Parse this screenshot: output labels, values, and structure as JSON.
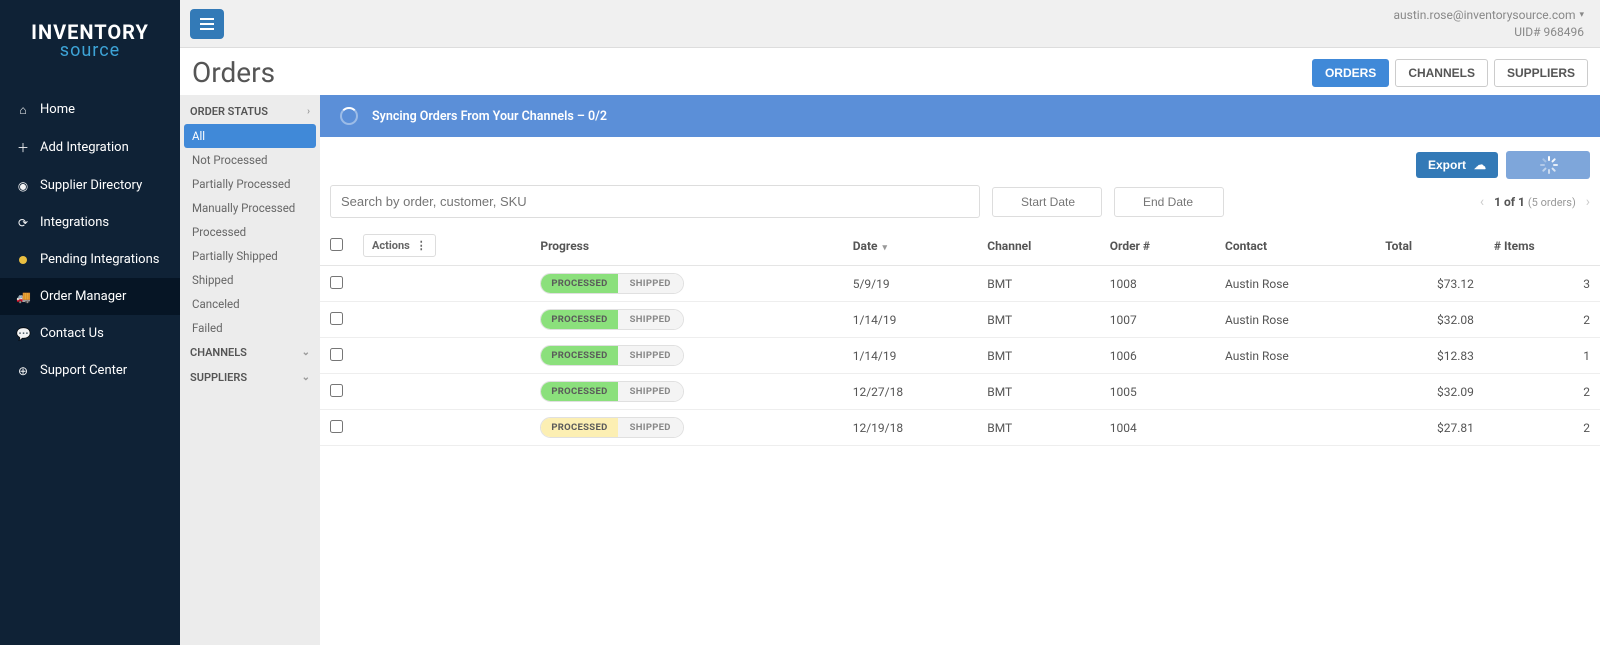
{
  "logo": {
    "line1": "INVENTORY",
    "line2": "source"
  },
  "topbar": {
    "email": "austin.rose@inventorysource.com",
    "uid_label": "UID# 968496"
  },
  "nav": {
    "home": "Home",
    "add_integration": "Add Integration",
    "supplier_directory": "Supplier Directory",
    "integrations": "Integrations",
    "pending_integrations": "Pending Integrations",
    "order_manager": "Order Manager",
    "contact_us": "Contact Us",
    "support_center": "Support Center"
  },
  "page": {
    "title": "Orders",
    "tabs": {
      "orders": "ORDERS",
      "channels": "CHANNELS",
      "suppliers": "SUPPLIERS"
    }
  },
  "filters": {
    "order_status_header": "ORDER STATUS",
    "statuses": {
      "all": "All",
      "not_processed": "Not Processed",
      "partially_processed": "Partially Processed",
      "manually_processed": "Manually Processed",
      "processed": "Processed",
      "partially_shipped": "Partially Shipped",
      "shipped": "Shipped",
      "canceled": "Canceled",
      "failed": "Failed"
    },
    "channels_header": "CHANNELS",
    "suppliers_header": "SUPPLIERS"
  },
  "banner": {
    "text": "Syncing Orders From Your Channels – 0/2"
  },
  "toolbar": {
    "export_label": "Export",
    "search_placeholder": "Search by order, customer, SKU",
    "start_date_placeholder": "Start Date",
    "end_date_placeholder": "End Date",
    "pager_main": "1 of 1",
    "pager_sub": "(5 orders)",
    "actions_label": "Actions"
  },
  "columns": {
    "progress": "Progress",
    "date": "Date",
    "channel": "Channel",
    "order": "Order #",
    "contact": "Contact",
    "total": "Total",
    "items": "# Items"
  },
  "pills": {
    "processed": "PROCESSED",
    "shipped": "SHIPPED"
  },
  "rows": [
    {
      "status": "green",
      "date": "5/9/19",
      "channel": "BMT",
      "order": "1008",
      "contact": "Austin Rose",
      "total": "$73.12",
      "items": "3"
    },
    {
      "status": "green",
      "date": "1/14/19",
      "channel": "BMT",
      "order": "1007",
      "contact": "Austin Rose",
      "total": "$32.08",
      "items": "2"
    },
    {
      "status": "green",
      "date": "1/14/19",
      "channel": "BMT",
      "order": "1006",
      "contact": "Austin Rose",
      "total": "$12.83",
      "items": "1"
    },
    {
      "status": "green",
      "date": "12/27/18",
      "channel": "BMT",
      "order": "1005",
      "contact": "",
      "total": "$32.09",
      "items": "2"
    },
    {
      "status": "warn",
      "date": "12/19/18",
      "channel": "BMT",
      "order": "1004",
      "contact": "",
      "total": "$27.81",
      "items": "2"
    }
  ]
}
